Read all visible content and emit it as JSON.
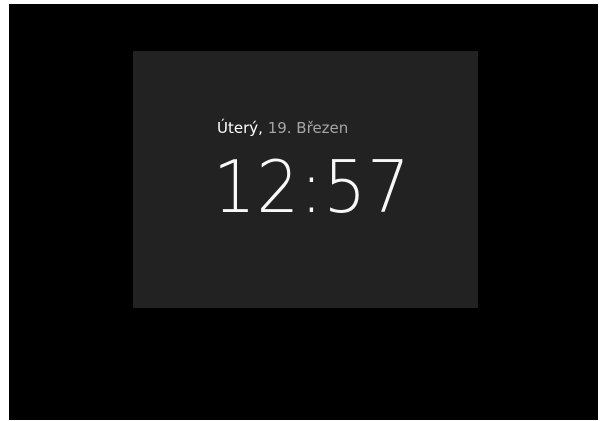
{
  "lockscreen": {
    "date": {
      "weekday": "Úterý,",
      "day_month": "19. Březen"
    },
    "time": "12:57"
  },
  "colors": {
    "background": "#000000",
    "panel": "#222222",
    "primary_text": "#ffffff",
    "secondary_text": "#a6a6a6"
  }
}
